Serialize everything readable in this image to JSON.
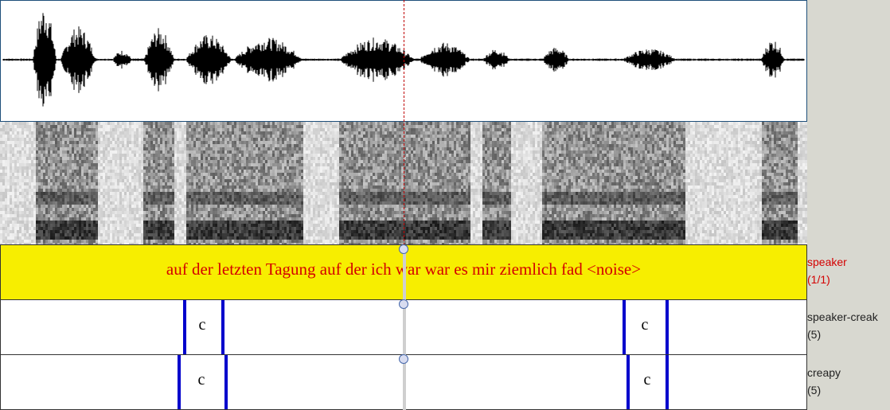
{
  "transcript": "auf der letzten Tagung auf der ich war war es mir ziemlich fad <noise>",
  "tiers": [
    {
      "name": "speaker",
      "count": "(1/1)",
      "color": "#d40000"
    },
    {
      "name": "speaker-creak",
      "count": "(5)",
      "color": "#222222"
    },
    {
      "name": "creapy",
      "count": "(5)",
      "color": "#222222"
    }
  ],
  "creak_segments": [
    {
      "label": "c"
    },
    {
      "label": "c"
    }
  ],
  "creapy_segments": [
    {
      "label": "c"
    },
    {
      "label": "c"
    }
  ],
  "colors": {
    "speaker_tier": "#f7ee00",
    "transcript_text": "#d40000",
    "boundary": "#0000cc",
    "cursor": "#c00000",
    "sidebar": "#d8d8d0"
  }
}
